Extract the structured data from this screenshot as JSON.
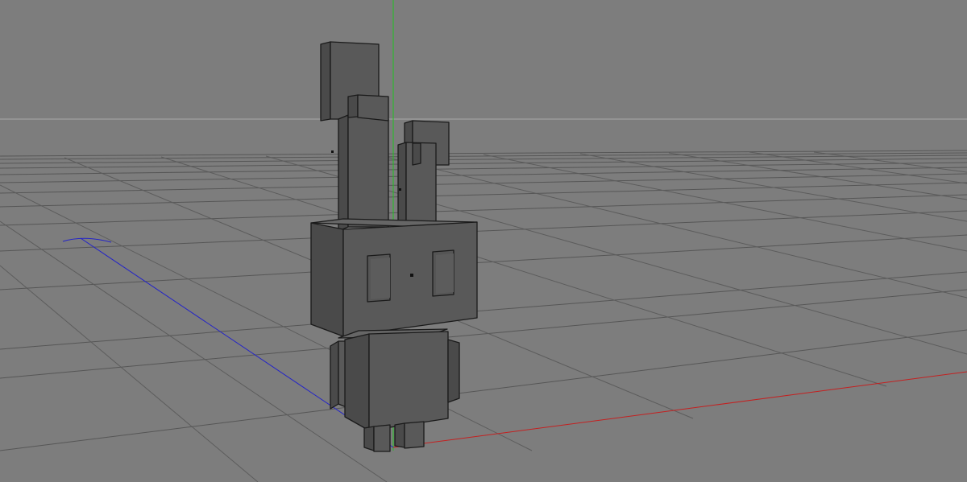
{
  "viewport": {
    "background": "#7d7d7d",
    "grid_color": "#5c5c5c",
    "horizon_color": "#a9a9a9"
  },
  "axes": {
    "x_color": "#c42020",
    "y_color": "#1ec21e",
    "z_color": "#2323c8"
  },
  "model": {
    "face_front": "#595959",
    "face_side": "#4a4a4a",
    "face_top": "#666666",
    "edge": "#1a1a1a"
  }
}
